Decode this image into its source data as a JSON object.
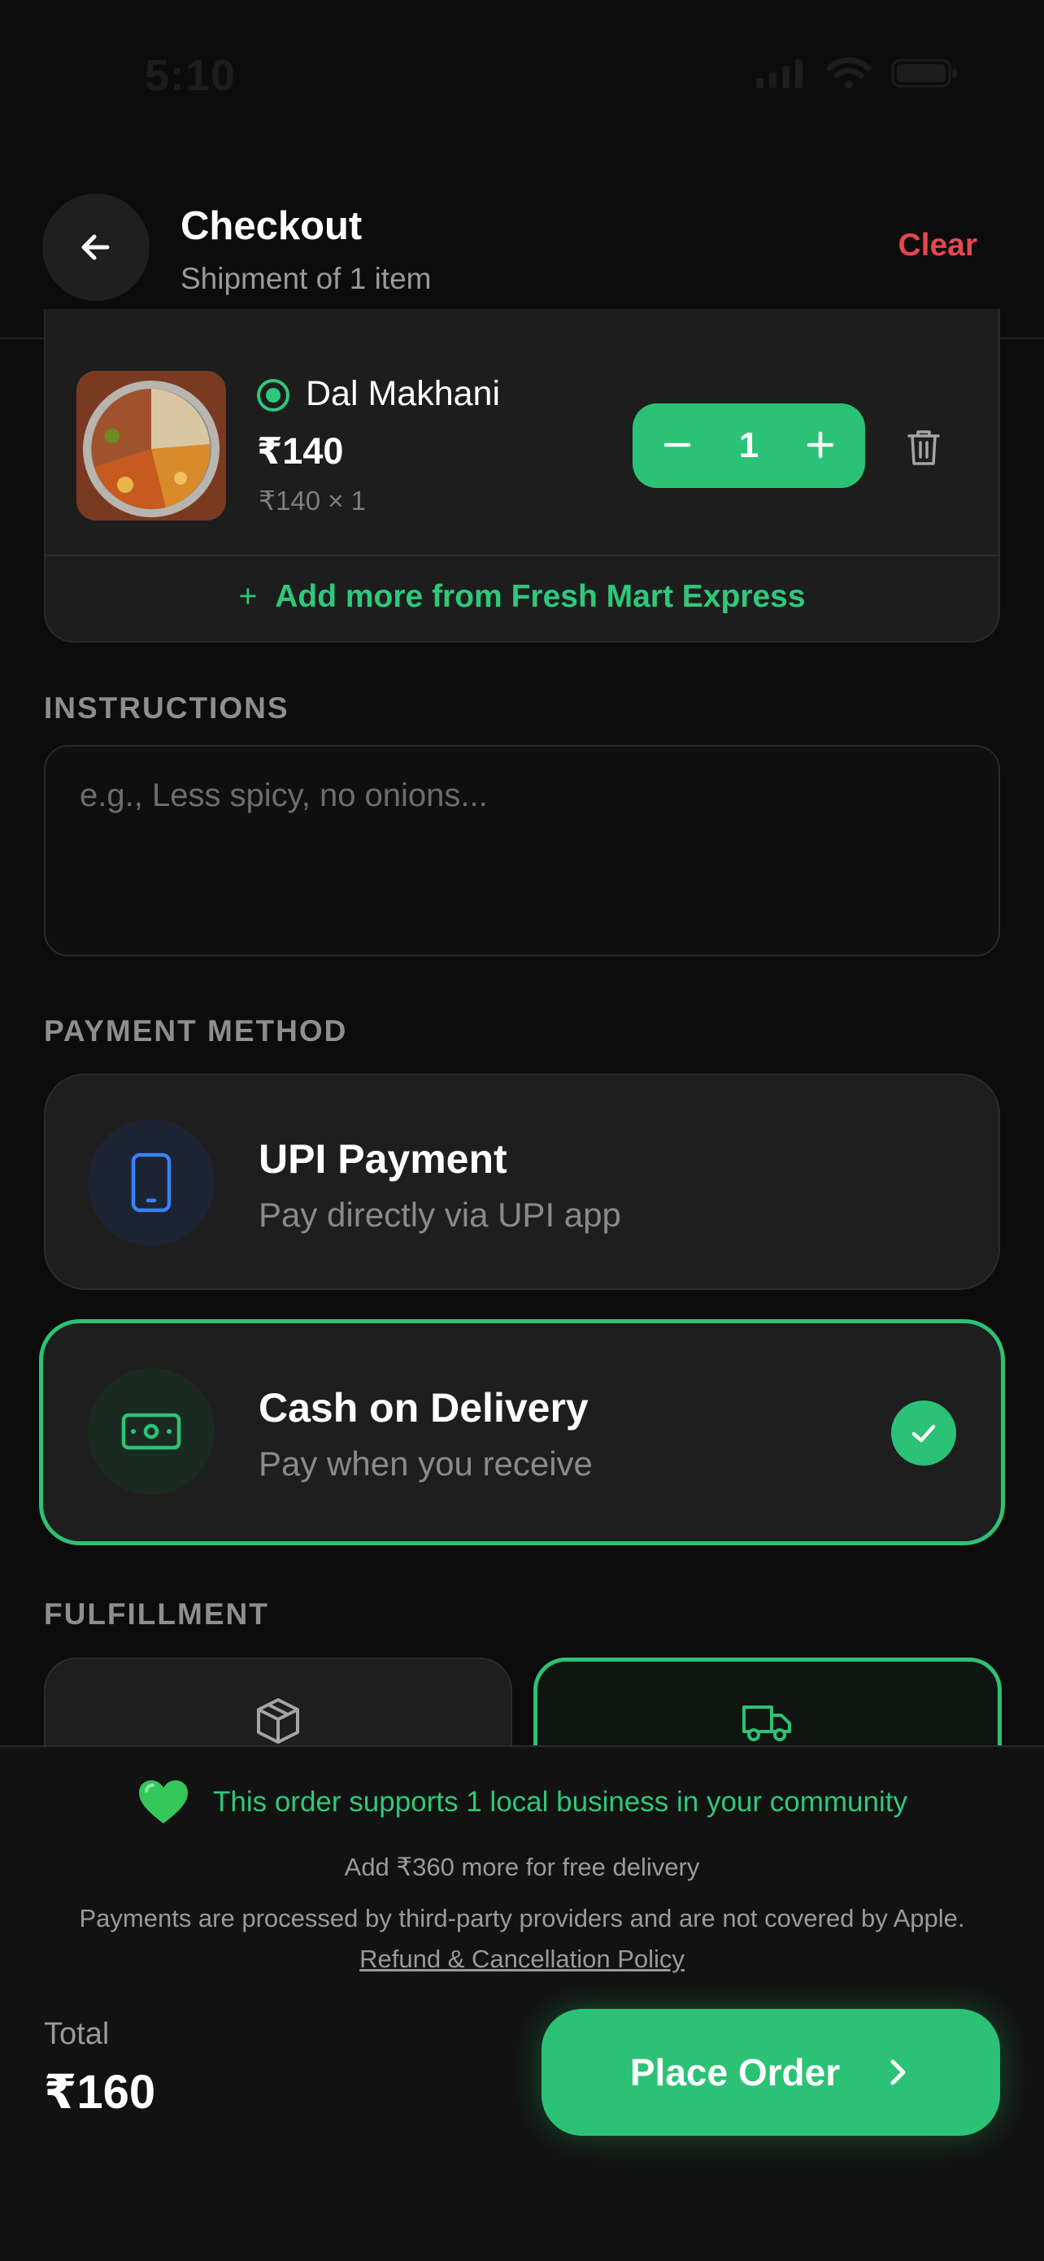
{
  "status_bar": {
    "time": "5:10"
  },
  "header": {
    "title": "Checkout",
    "subtitle": "Shipment of 1 item",
    "clear_label": "Clear"
  },
  "cart": {
    "item": {
      "name": "Dal Makhani",
      "price": "₹140",
      "price_detail": "₹140 × 1",
      "quantity": "1",
      "veg": true
    },
    "add_more_label": "Add more from Fresh Mart Express"
  },
  "instructions": {
    "label": "INSTRUCTIONS",
    "placeholder": "e.g., Less spicy, no onions...",
    "value": ""
  },
  "payment": {
    "label": "PAYMENT METHOD",
    "options": [
      {
        "title": "UPI Payment",
        "subtitle": "Pay directly via UPI app",
        "icon": "phone-icon",
        "selected": false
      },
      {
        "title": "Cash on Delivery",
        "subtitle": "Pay when you receive",
        "icon": "cash-icon",
        "selected": true
      }
    ]
  },
  "fulfillment": {
    "label": "FULFILLMENT",
    "options": [
      {
        "icon": "package-icon",
        "selected": false
      },
      {
        "icon": "truck-icon",
        "selected": true
      }
    ]
  },
  "footer": {
    "support_text": "This order supports 1 local business in your community",
    "free_delivery_text": "Add ₹360 more for free delivery",
    "legal_text": "Payments are processed by third-party providers and are not covered by Apple.",
    "policy_link": "Refund & Cancellation Policy",
    "total_label": "Total",
    "total_value": "₹160",
    "place_order_label": "Place Order"
  },
  "colors": {
    "accent": "#2cc275",
    "danger": "#e5484d",
    "background": "#0c0c0c",
    "card": "#1e1e1e"
  }
}
